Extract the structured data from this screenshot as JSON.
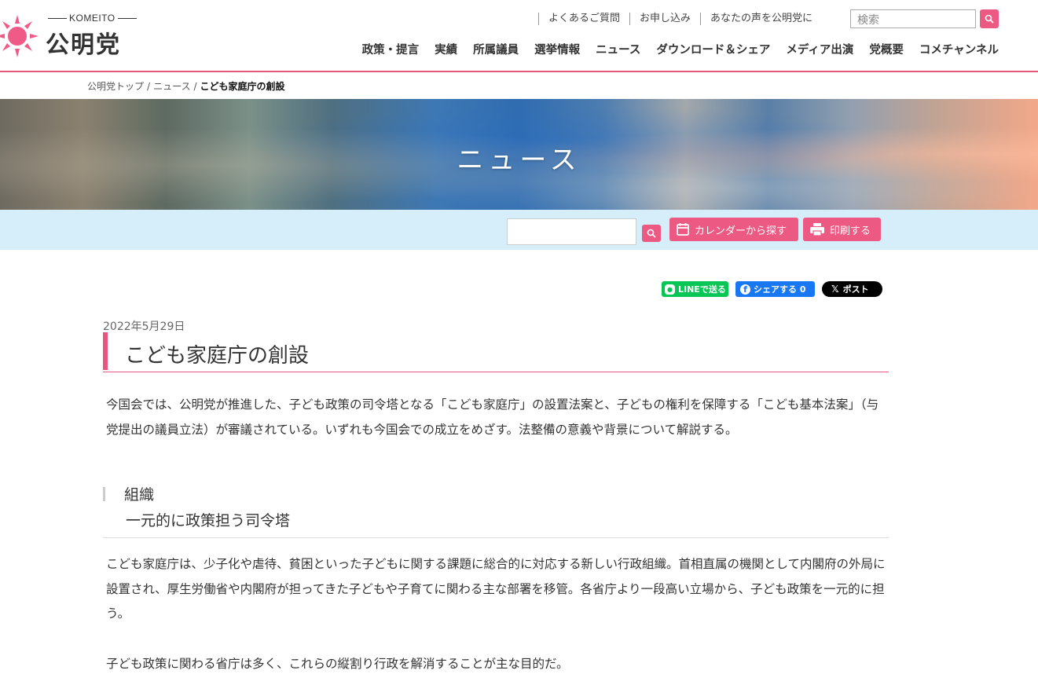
{
  "header": {
    "logo_sub": "KOMEITO",
    "logo_name": "公明党",
    "util_links": [
      "よくあるご質問",
      "お申し込み",
      "あなたの声を公明党に"
    ],
    "search_placeholder": "検索",
    "nav": [
      "政策・提言",
      "実績",
      "所属議員",
      "選挙情報",
      "ニュース",
      "ダウンロード＆シェア",
      "メディア出演",
      "党概要",
      "コメチャンネル"
    ]
  },
  "breadcrumb": {
    "items": [
      "公明党トップ",
      "ニュース"
    ],
    "current": "こども家庭庁の創設"
  },
  "hero": {
    "title": "ニュース"
  },
  "toolbar": {
    "calendar_label": "カレンダーから探す",
    "print_label": "印刷する"
  },
  "social": {
    "line_label": "LINEで送る",
    "fb_label": "シェアする 0",
    "x_label": "ポスト"
  },
  "article": {
    "date": "2022年5月29日",
    "title": "こども家庭庁の創設",
    "lead": "今国会では、公明党が推進した、子ども政策の司令塔となる「こども家庭庁」の設置法案と、子どもの権利を保障する「こども基本法案」（与党提出の議員立法）が審議されている。いずれも今国会での成立をめざす。法整備の意義や背景について解説する。",
    "section_label": "組織",
    "section_title": "一元的に政策担う司令塔",
    "body1": "こども家庭庁は、少子化や虐待、貧困といった子どもに関する課題に総合的に対応する新しい行政組織。首相直属の機関として内閣府の外局に設置され、厚生労働省や内閣府が担ってきた子どもや子育てに関わる主な部署を移管。各省庁より一段高い立場から、子ども政策を一元的に担う。",
    "body2": "子ども政策に関わる省庁は多く、これらの縦割り行政を解消することが主な目的だ。"
  },
  "colors": {
    "accent": "#e8557f",
    "toolbar_bg": "#d6eef9"
  }
}
